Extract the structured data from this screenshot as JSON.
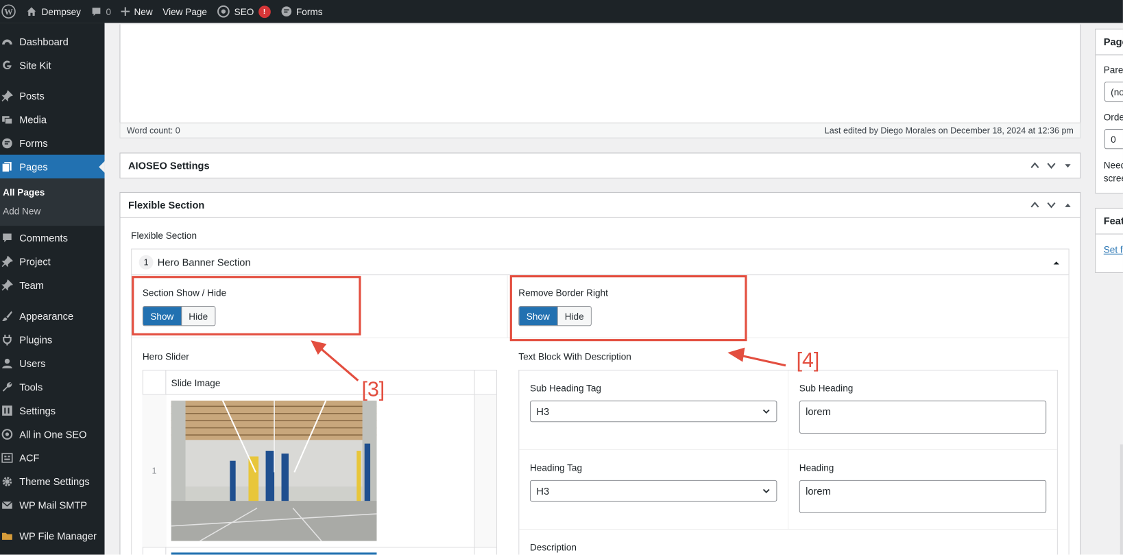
{
  "admin_bar": {
    "site_name": "Dempsey",
    "comments_count": "0",
    "new_label": "New",
    "view_page_label": "View Page",
    "seo_label": "SEO",
    "seo_badge": "!",
    "forms_label": "Forms"
  },
  "sidebar": {
    "items_top": [
      {
        "label": "Dashboard",
        "icon": "dashboard-icon"
      },
      {
        "label": "Site Kit",
        "icon": "google-icon"
      }
    ],
    "items_mid": [
      {
        "label": "Posts",
        "icon": "pin-icon"
      },
      {
        "label": "Media",
        "icon": "media-icon"
      },
      {
        "label": "Forms",
        "icon": "forms-icon"
      },
      {
        "label": "Pages",
        "icon": "pages-icon"
      }
    ],
    "submenu": [
      "All Pages",
      "Add New"
    ],
    "items_after": [
      {
        "label": "Comments",
        "icon": "comment-icon"
      },
      {
        "label": "Project",
        "icon": "pin-icon"
      },
      {
        "label": "Team",
        "icon": "pin-icon"
      }
    ],
    "items_bottom": [
      {
        "label": "Appearance",
        "icon": "brush-icon"
      },
      {
        "label": "Plugins",
        "icon": "plug-icon"
      },
      {
        "label": "Users",
        "icon": "user-icon"
      },
      {
        "label": "Tools",
        "icon": "wrench-icon"
      },
      {
        "label": "Settings",
        "icon": "settings-icon"
      },
      {
        "label": "All in One SEO",
        "icon": "aioseo-icon"
      },
      {
        "label": "ACF",
        "icon": "acf-icon"
      },
      {
        "label": "Theme Settings",
        "icon": "gear-icon"
      },
      {
        "label": "WP Mail SMTP",
        "icon": "mail-icon"
      }
    ],
    "file_manager": {
      "label": "WP File Manager",
      "icon": "folder-icon"
    }
  },
  "editor_footer": {
    "word_count": "Word count: 0",
    "last_edited": "Last edited by Diego Morales on December 18, 2024 at 12:36 pm"
  },
  "aioseo_box": {
    "title": "AIOSEO Settings"
  },
  "flexible_box": {
    "title": "Flexible Section",
    "field_label": "Flexible Section",
    "layout_index": "1",
    "layout_title": "Hero Banner Section",
    "section_show_hide": {
      "label": "Section Show / Hide",
      "show": "Show",
      "hide": "Hide",
      "selected": "Show"
    },
    "remove_border_right": {
      "label": "Remove Border Right",
      "show": "Show",
      "hide": "Hide",
      "selected": "Show"
    },
    "hero_slider": {
      "label": "Hero Slider",
      "column_header": "Slide Image",
      "row_index": "1"
    },
    "text_block": {
      "label": "Text Block With Description",
      "sub_heading_tag_label": "Sub Heading Tag",
      "sub_heading_tag_value": "H3",
      "sub_heading_label": "Sub Heading",
      "sub_heading_value": "lorem",
      "heading_tag_label": "Heading Tag",
      "heading_tag_value": "H3",
      "heading_label": "Heading",
      "heading_value": "lorem",
      "description_label": "Description"
    }
  },
  "annotations": {
    "callout_3": "[3]",
    "callout_4": "[4]"
  },
  "right_sidebar": {
    "page_attributes_title": "Page",
    "parent_label": "Pare",
    "parent_value": "(no",
    "order_label": "Orde",
    "order_value": "0",
    "help_line1": "Need",
    "help_line2": "scree",
    "featured_title": "Feat",
    "set_featured_link": "Set f"
  },
  "colors": {
    "accent": "#2271b1",
    "admin_dark": "#1d2327",
    "annotation_red": "#e34e3f"
  }
}
